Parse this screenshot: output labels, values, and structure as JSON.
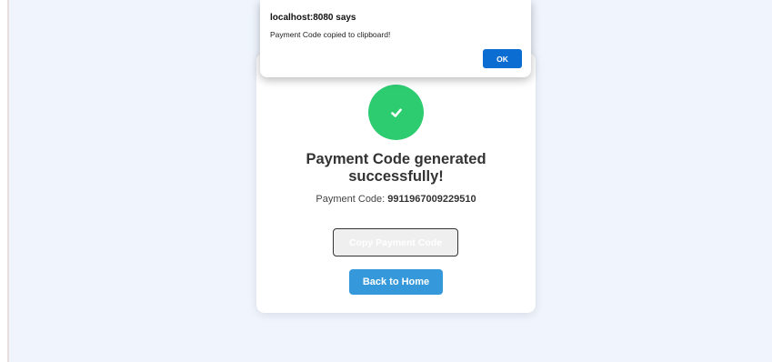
{
  "dialog": {
    "title": "localhost:8080 says",
    "message": "Payment Code copied to clipboard!",
    "ok_label": "OK"
  },
  "card": {
    "icon": "check-icon",
    "success_title": "Payment Code generated successfully!",
    "code_label": "Payment Code:",
    "code_value": "9911967009229510",
    "copy_button_label": "Copy Payment Code",
    "home_button_label": "Back to Home"
  },
  "colors": {
    "success_green": "#2ecc71",
    "home_button_blue": "#3498db",
    "dialog_ok_blue": "#0b6cd2",
    "page_background": "#eff4fd"
  }
}
